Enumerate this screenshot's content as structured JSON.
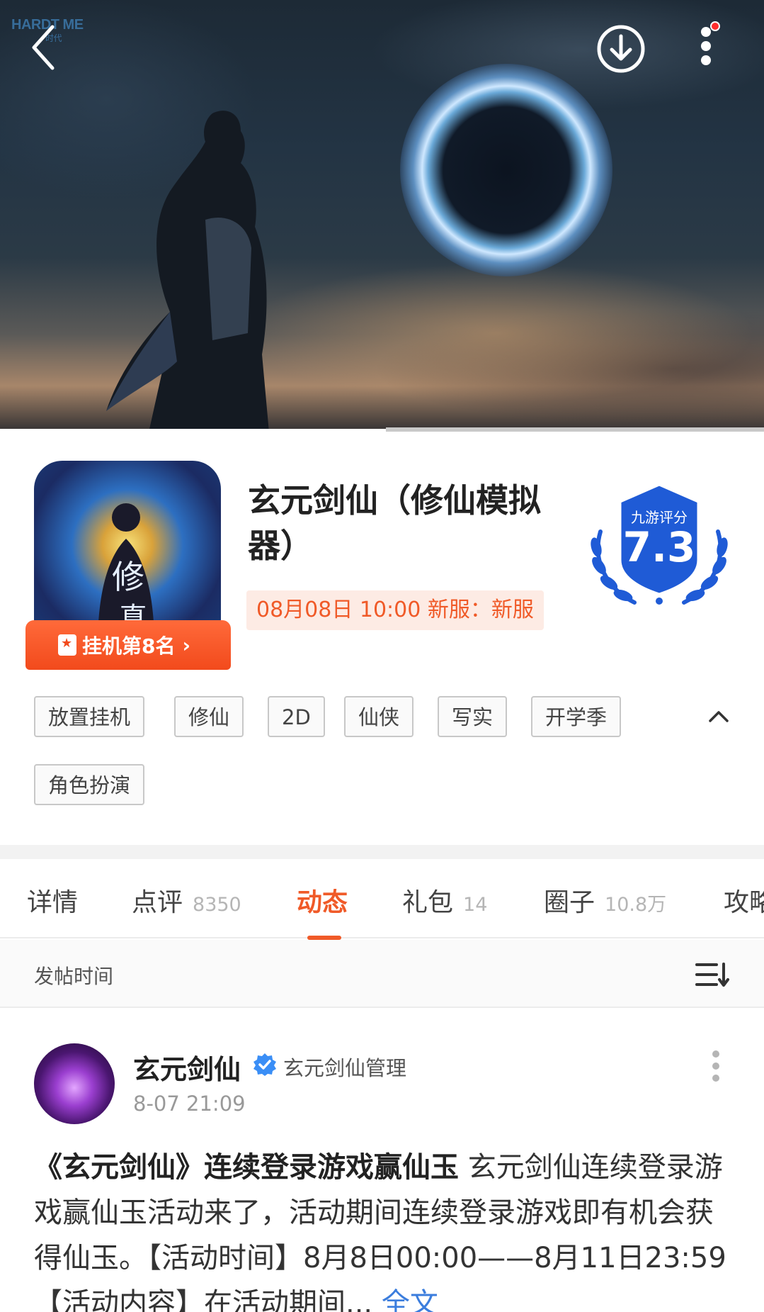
{
  "hero": {
    "watermark_main": "HARDT ME",
    "watermark_sub": "时代"
  },
  "game": {
    "title": "玄元剑仙（修仙模拟器）",
    "rank_label": "挂机第8名",
    "server_info": "08月08日 10:00 新服：新服",
    "score_label": "九游评分",
    "score_value": "7.3"
  },
  "tags": [
    "放置挂机",
    "修仙",
    "2D",
    "仙侠",
    "写实",
    "开学季",
    "角色扮演"
  ],
  "tabs": [
    {
      "label": "详情",
      "count": ""
    },
    {
      "label": "点评",
      "count": "8350"
    },
    {
      "label": "动态",
      "count": ""
    },
    {
      "label": "礼包",
      "count": "14"
    },
    {
      "label": "圈子",
      "count": "10.8万"
    },
    {
      "label": "攻略",
      "count": ""
    }
  ],
  "active_tab": "动态",
  "sort": {
    "label": "发帖时间"
  },
  "post": {
    "author": "玄元剑仙",
    "role": "玄元剑仙管理",
    "time": "8-07 21:09",
    "headline": "《玄元剑仙》连续登录游戏赢仙玉",
    "body": " 玄元剑仙连续登录游戏赢仙玉活动来了，活动期间连续登录游戏即有机会获得仙玉。【活动时间】8月8日00:00——8月11日23:59【活动内容】在活动期间...",
    "more_label": "全文"
  },
  "colors": {
    "accent": "#f05a28",
    "score_blue": "#1f5bd6",
    "link_blue": "#3b7ddd"
  }
}
